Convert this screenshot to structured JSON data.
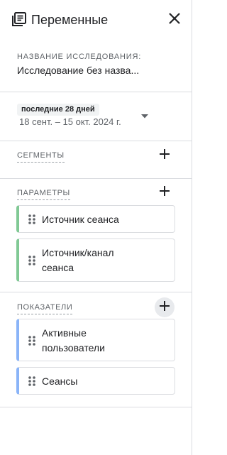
{
  "header": {
    "title": "Переменные",
    "icon": "variables-list-icon",
    "close_icon": "close-icon"
  },
  "exploration": {
    "label": "НАЗВАНИЕ ИССЛЕДОВАНИЯ:",
    "value": "Исследование без назва..."
  },
  "date_range": {
    "preset": "последние 28 дней",
    "range": "18 сент. – 15 окт. 2024 г."
  },
  "segments": {
    "label": "СЕГМЕНТЫ"
  },
  "dimensions": {
    "label": "ПАРАМЕТРЫ",
    "items": [
      {
        "label": "Источник сеанса"
      },
      {
        "label": "Источник/канал сеанса"
      }
    ]
  },
  "metrics": {
    "label": "ПОКАЗАТЕЛИ",
    "items": [
      {
        "label": "Активные пользователи"
      },
      {
        "label": "Сеансы"
      }
    ]
  },
  "colors": {
    "dimension_accent": "#81c995",
    "metric_accent": "#8ab4f8",
    "divider": "#dadce0",
    "text_secondary": "#5f6368"
  }
}
